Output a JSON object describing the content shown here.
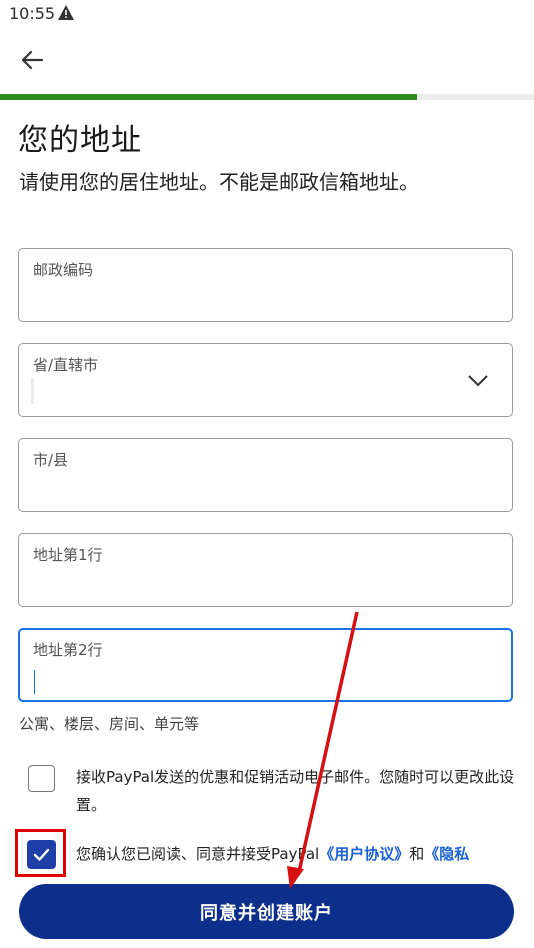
{
  "status_bar": {
    "time": "10:55",
    "warning_icon": "warning-triangle-icon"
  },
  "nav": {
    "back_icon": "arrow-left-icon"
  },
  "progress": {
    "fraction": 0.78,
    "color": "#2e8b1e"
  },
  "header": {
    "title": "您的地址",
    "subtitle": "请使用您的居住地址。不能是邮政信箱地址。"
  },
  "form": {
    "postal_code": {
      "label": "邮政编码",
      "value": ""
    },
    "province": {
      "label": "省/直辖市",
      "value": "",
      "dropdown_icon": "chevron-down-icon"
    },
    "city": {
      "label": "市/县",
      "value": ""
    },
    "address_line1": {
      "label": "地址第1行",
      "value": ""
    },
    "address_line2": {
      "label": "地址第2行",
      "value": "",
      "helper": "公寓、楼层、房间、单元等"
    }
  },
  "consent": {
    "marketing": {
      "checked": false,
      "text": "接收PayPal发送的优惠和促销活动电子邮件。您随时可以更改此设置。"
    },
    "terms": {
      "checked": true,
      "text_prefix": "您确认您已阅读、同意并接受PayPal",
      "user_agreement_link": "《用户协议》",
      "conjunction": "和",
      "privacy_link": "《隐私"
    }
  },
  "submit": {
    "label": "同意并创建账户"
  },
  "colors": {
    "primary_button": "#0b2f8a",
    "focus_border": "#1a73e8",
    "checkbox_checked": "#1e3fa8",
    "link": "#1a61d3",
    "annotation_red": "#e00000"
  }
}
